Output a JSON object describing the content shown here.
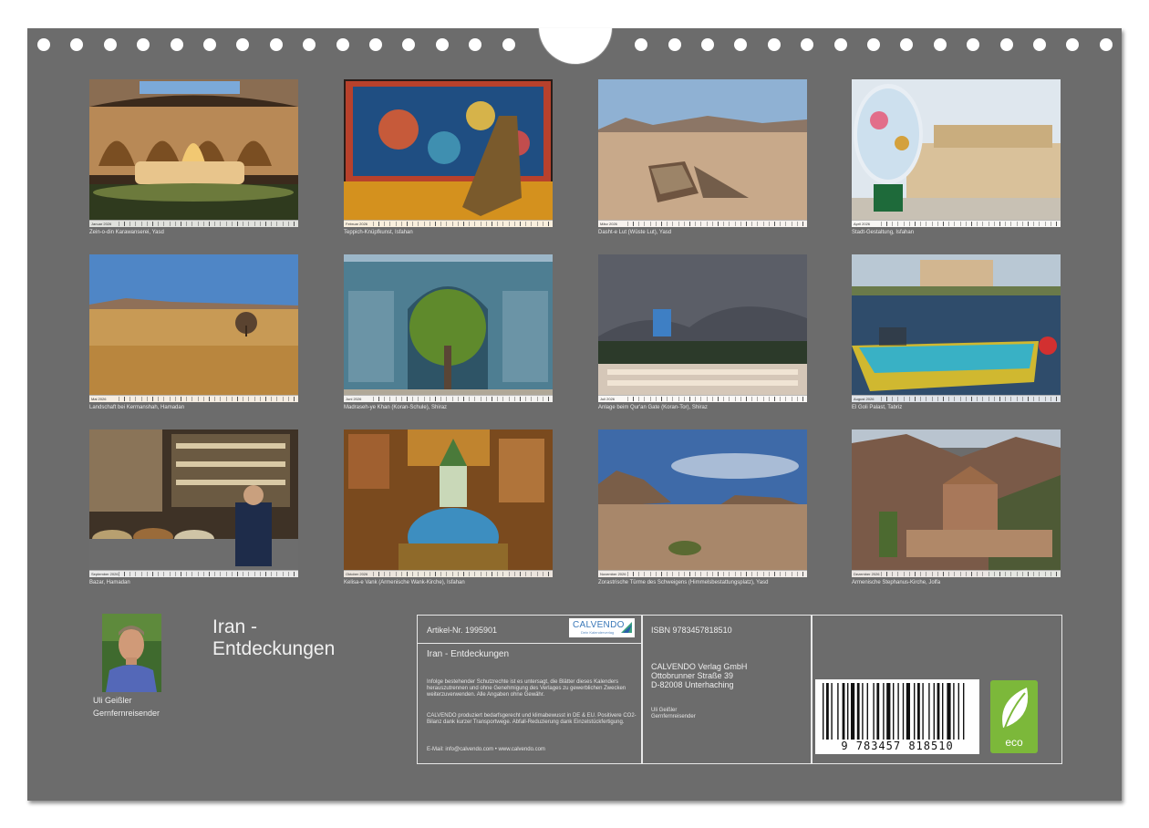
{
  "tiles": [
    {
      "caption": "Zein-o-din Karawanserei, Yasd",
      "month": "Januar 2026"
    },
    {
      "caption": "Teppich-Knüpfkunst, Isfahan",
      "month": "Februar 2026"
    },
    {
      "caption": "Dasht-e Lut (Wüste Lut), Yasd",
      "month": "März 2026"
    },
    {
      "caption": "Stadt-Gestaltung, Isfahan",
      "month": "April 2026"
    },
    {
      "caption": "Landschaft bei Kermanshah, Hamadan",
      "month": "Mai 2026"
    },
    {
      "caption": "Madraseh-ye Khan (Koran-Schule), Shiraz",
      "month": "Juni 2026"
    },
    {
      "caption": "Anlage beim Qur'an Gate (Koran-Tor), Shiraz",
      "month": "Juli 2026"
    },
    {
      "caption": "El Goli Palast, Tabriz",
      "month": "August 2026"
    },
    {
      "caption": "Bazar, Hamadan",
      "month": "September 2026"
    },
    {
      "caption": "Kelisa-e Vank (Armenische Wank-Kirche), Isfahan",
      "month": "Oktober 2026"
    },
    {
      "caption": "Zorastrische Türme des Schweigens (Himmelsbestattungsplatz), Yasd",
      "month": "November 2026"
    },
    {
      "caption": "Armenische Stephanus-Kirche, Jolfa",
      "month": "Dezember 2026"
    }
  ],
  "author": {
    "name": "Uli Geißler",
    "role": "Gernfernreisender"
  },
  "calendar_title": [
    "Iran -",
    "Entdeckungen"
  ],
  "info": {
    "article": "Artikel-Nr. 1995901",
    "title": "Iran - Entdeckungen",
    "legal": "Infolge bestehender Schutzrechte ist es untersagt, die Blätter dieses Kalenders herauszutrennen und ohne Genehmigung des Verlages zu gewerblichen Zwecken weiterzuverwenden. Alle Angaben ohne Gewähr.",
    "production": "CALVENDO produziert bedarfsgerecht und klimabewusst in DE & EU. Positivere CO2-Bilanz dank kurzer Transportwege. Abfall-Reduzierung dank Einzelstückfertigung.",
    "contact": "E-Mail: info@calvendo.com • www.calvendo.com",
    "isbn": "ISBN 9783457818510",
    "publisher": [
      "CALVENDO Verlag GmbH",
      "Ottobrunner Straße 39",
      "D-82008 Unterhaching"
    ],
    "author_small": [
      "Uli Geißler",
      "Gernfernreisender"
    ],
    "barcode_digits": "9 783457 818510",
    "eco_label": "eco"
  },
  "logo": {
    "brand": "CALVENDO",
    "tagline": "Dein Kalenderverlag"
  },
  "colors": {
    "board": "#6c6c6c",
    "eco_green": "#7cb83a",
    "calvendo_blue": "#3a78b8"
  }
}
